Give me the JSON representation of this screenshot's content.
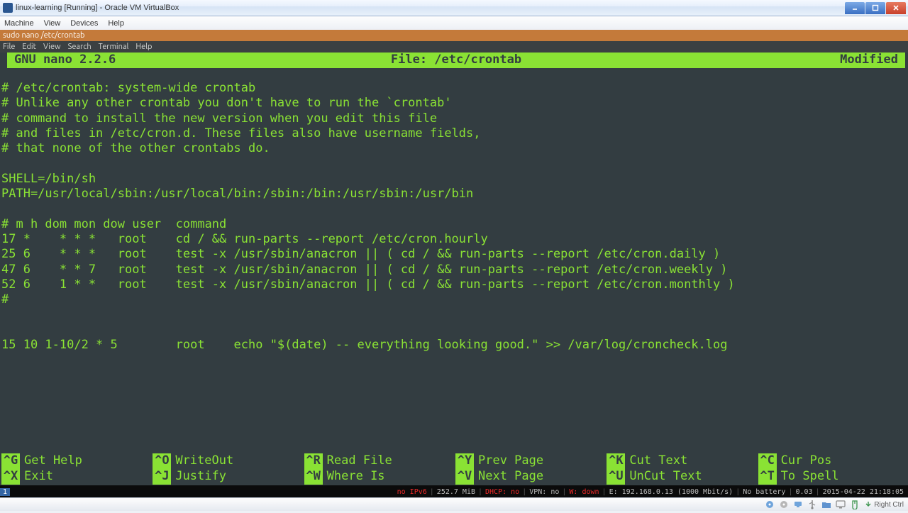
{
  "colors": {
    "nano_green": "#8ae234",
    "nano_bg": "#333d41",
    "gnome_titlebar": "#c47a3a"
  },
  "virtualbox": {
    "window_title": "linux-learning [Running] - Oracle VM VirtualBox",
    "menu": [
      "Machine",
      "View",
      "Devices",
      "Help"
    ],
    "host_key": "Right Ctrl"
  },
  "gnome": {
    "window_title": "sudo nano /etc/crontab",
    "menu": [
      "File",
      "Edit",
      "View",
      "Search",
      "Terminal",
      "Help"
    ],
    "statusbar": {
      "workspace": "1",
      "segments": [
        {
          "text": "no IPv6",
          "class": "red"
        },
        {
          "text": "252.7 MiB"
        },
        {
          "text": "DHCP: no",
          "class": "red"
        },
        {
          "text": "VPN: no"
        },
        {
          "text": "W: down",
          "class": "red"
        },
        {
          "text": "E: 192.168.0.13 (1000 Mbit/s)"
        },
        {
          "text": "No battery"
        },
        {
          "text": "0.03"
        },
        {
          "text": "2015-04-22 21:18:05"
        }
      ]
    }
  },
  "nano": {
    "version": "GNU nano 2.2.6",
    "file_label": "File: /etc/crontab",
    "modified": "Modified",
    "body_lines": [
      "# /etc/crontab: system-wide crontab",
      "# Unlike any other crontab you don't have to run the `crontab'",
      "# command to install the new version when you edit this file",
      "# and files in /etc/cron.d. These files also have username fields,",
      "# that none of the other crontabs do.",
      "",
      "SHELL=/bin/sh",
      "PATH=/usr/local/sbin:/usr/local/bin:/sbin:/bin:/usr/sbin:/usr/bin",
      "",
      "# m h dom mon dow user  command",
      "17 *    * * *   root    cd / && run-parts --report /etc/cron.hourly",
      "25 6    * * *   root    test -x /usr/sbin/anacron || ( cd / && run-parts --report /etc/cron.daily )",
      "47 6    * * 7   root    test -x /usr/sbin/anacron || ( cd / && run-parts --report /etc/cron.weekly )",
      "52 6    1 * *   root    test -x /usr/sbin/anacron || ( cd / && run-parts --report /etc/cron.monthly )",
      "#",
      "",
      "",
      "15 10 1-10/2 * 5        root    echo \"$(date) -- everything looking good.\" >> /var/log/croncheck.log"
    ],
    "shortcuts": [
      {
        "key": "^G",
        "label": "Get Help"
      },
      {
        "key": "^X",
        "label": "Exit"
      },
      {
        "key": "^O",
        "label": "WriteOut"
      },
      {
        "key": "^J",
        "label": "Justify"
      },
      {
        "key": "^R",
        "label": "Read File"
      },
      {
        "key": "^W",
        "label": "Where Is"
      },
      {
        "key": "^Y",
        "label": "Prev Page"
      },
      {
        "key": "^V",
        "label": "Next Page"
      },
      {
        "key": "^K",
        "label": "Cut Text"
      },
      {
        "key": "^U",
        "label": "UnCut Text"
      },
      {
        "key": "^C",
        "label": "Cur Pos"
      },
      {
        "key": "^T",
        "label": "To Spell"
      }
    ]
  }
}
